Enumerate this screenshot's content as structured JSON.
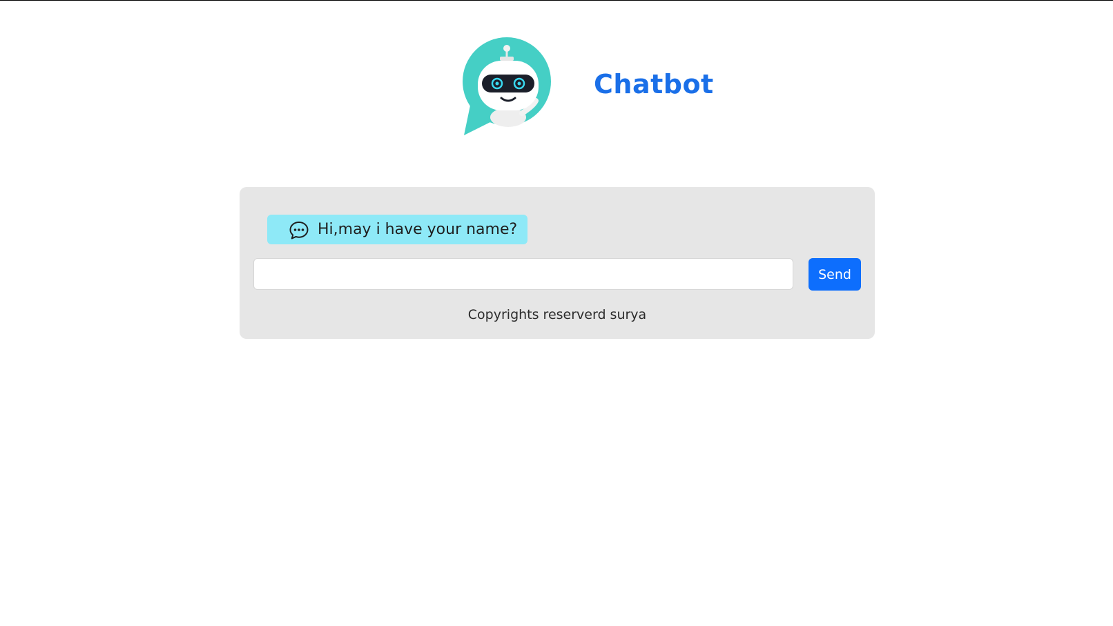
{
  "colors": {
    "brand_blue": "#1a6fe8",
    "card_bg": "#e6e6e6",
    "bubble_bg": "#8ee9f7",
    "send_button_bg": "#0d6efd",
    "logo_teal": "#45cfc5"
  },
  "header": {
    "title": "Chatbot",
    "logo_icon": "robot-chat-bubble-icon"
  },
  "chat": {
    "messages": [
      {
        "icon": "chat-dots-icon",
        "text": "Hi,may i have your name?"
      }
    ],
    "input": {
      "value": "",
      "placeholder": ""
    },
    "send_label": "Send",
    "footer": "Copyrights reserverd surya"
  }
}
